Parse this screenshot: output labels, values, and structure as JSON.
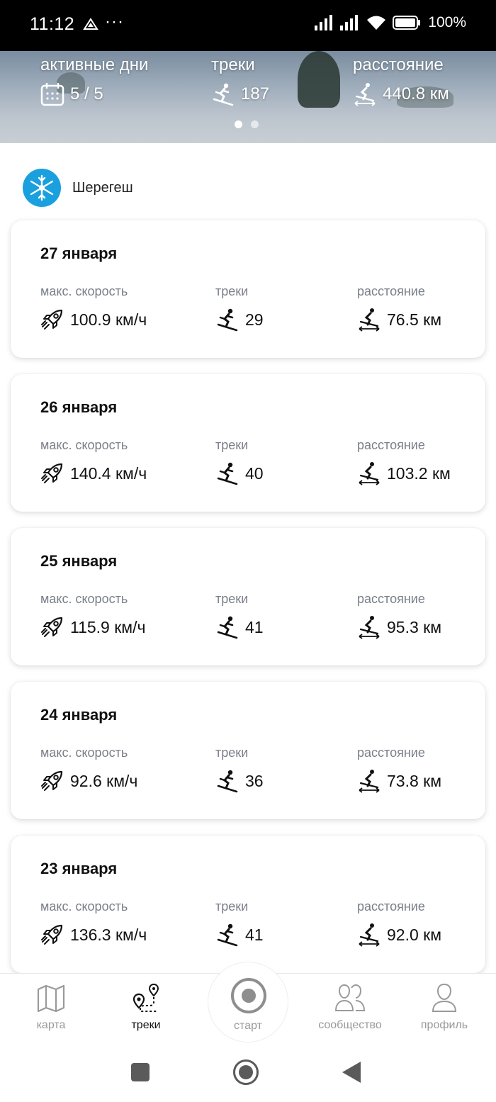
{
  "status_bar": {
    "time": "11:12",
    "more": "···",
    "battery": "100%"
  },
  "summary": {
    "active_days_label": "активные дни",
    "active_days_value": "5 / 5",
    "tracks_label": "треки",
    "tracks_value": "187",
    "distance_label": "расстояние",
    "distance_value": "440.8 км",
    "page_count": 2,
    "active_page": 1
  },
  "resort": {
    "name": "Шерегеш",
    "logo_color": "#1aa0de"
  },
  "columns": {
    "speed_label": "макс. скорость",
    "tracks_label": "треки",
    "distance_label": "расстояние"
  },
  "days": [
    {
      "date": "27 января",
      "max_speed": "100.9 км/ч",
      "tracks": "29",
      "distance": "76.5 км"
    },
    {
      "date": "26 января",
      "max_speed": "140.4 км/ч",
      "tracks": "40",
      "distance": "103.2 км"
    },
    {
      "date": "25 января",
      "max_speed": "115.9 км/ч",
      "tracks": "41",
      "distance": "95.3 км"
    },
    {
      "date": "24 января",
      "max_speed": "92.6 км/ч",
      "tracks": "36",
      "distance": "73.8 км"
    },
    {
      "date": "23 января",
      "max_speed": "136.3 км/ч",
      "tracks": "41",
      "distance": "92.0 км"
    }
  ],
  "bottom_nav": {
    "map": "карта",
    "tracks": "треки",
    "start": "старт",
    "community": "сообщество",
    "profile": "профиль",
    "active": "tracks"
  },
  "icons": {
    "speed": "rocket-icon",
    "tracks": "skier-icon",
    "distance": "skier-distance-icon",
    "calendar": "calendar-icon"
  }
}
